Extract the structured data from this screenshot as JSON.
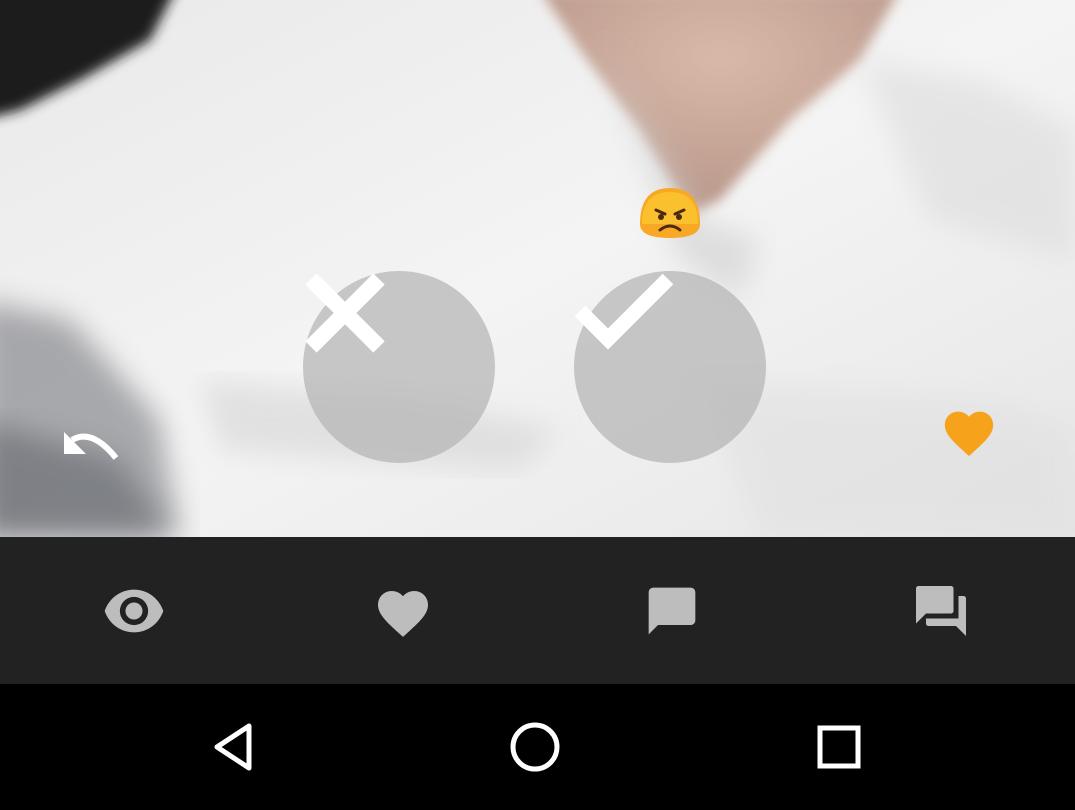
{
  "overlay": {
    "mood_emoji_icon": "angry-face-icon",
    "reject_icon": "close-icon",
    "accept_icon": "check-icon",
    "undo_icon": "undo-icon",
    "favorite_icon": "heart-icon",
    "favorite_color": "#F7A21B",
    "button_fill": "#B4B4B4"
  },
  "tabbar": {
    "background": "#222222",
    "icon_color": "#BDBDBD",
    "tabs": [
      {
        "icon": "eye-icon"
      },
      {
        "icon": "heart-icon"
      },
      {
        "icon": "chat-bubble-icon"
      },
      {
        "icon": "forum-icon"
      }
    ]
  },
  "navbar": {
    "buttons": [
      {
        "icon": "back-triangle-icon"
      },
      {
        "icon": "home-circle-icon"
      },
      {
        "icon": "recent-apps-square-icon"
      }
    ]
  }
}
